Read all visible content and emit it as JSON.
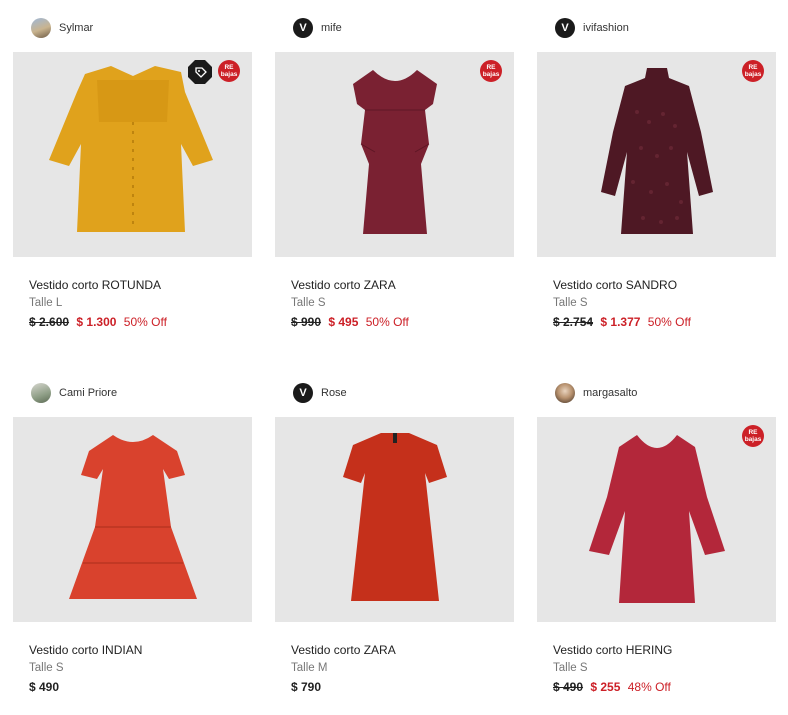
{
  "products": [
    {
      "seller": "Sylmar",
      "avatar_type": "photo",
      "title": "Vestido corto ROTUNDA",
      "size": "Talle L",
      "old_price": "$ 2.600",
      "price": "$ 1.300",
      "discount": "50% Off",
      "badge_line1": "RE",
      "badge_line2": "bajas",
      "has_tag_badge": true,
      "dress_color": "#e0a21c"
    },
    {
      "seller": "mife",
      "avatar_letter": "V",
      "title": "Vestido corto ZARA",
      "size": "Talle S",
      "old_price": "$ 990",
      "price": "$ 495",
      "discount": "50% Off",
      "badge_line1": "RE",
      "badge_line2": "bajas",
      "dress_color": "#7a2132"
    },
    {
      "seller": "ivifashion",
      "avatar_letter": "V",
      "title": "Vestido corto SANDRO",
      "size": "Talle S",
      "old_price": "$ 2.754",
      "price": "$ 1.377",
      "discount": "50% Off",
      "badge_line1": "RE",
      "badge_line2": "bajas",
      "dress_color": "#4e1824"
    },
    {
      "seller": "Cami Priore",
      "avatar_type": "photo",
      "title": "Vestido corto INDIAN",
      "size": "Talle S",
      "price": "$ 490",
      "dress_color": "#d9422d"
    },
    {
      "seller": "Rose",
      "avatar_letter": "V",
      "title": "Vestido corto ZARA",
      "size": "Talle M",
      "price": "$ 790",
      "dress_color": "#c5301b"
    },
    {
      "seller": "margasalto",
      "avatar_type": "photo",
      "title": "Vestido corto HERING",
      "size": "Talle S",
      "old_price": "$ 490",
      "price": "$ 255",
      "discount": "48% Off",
      "badge_line1": "RE",
      "badge_line2": "bajas",
      "dress_color": "#b3273a"
    }
  ]
}
